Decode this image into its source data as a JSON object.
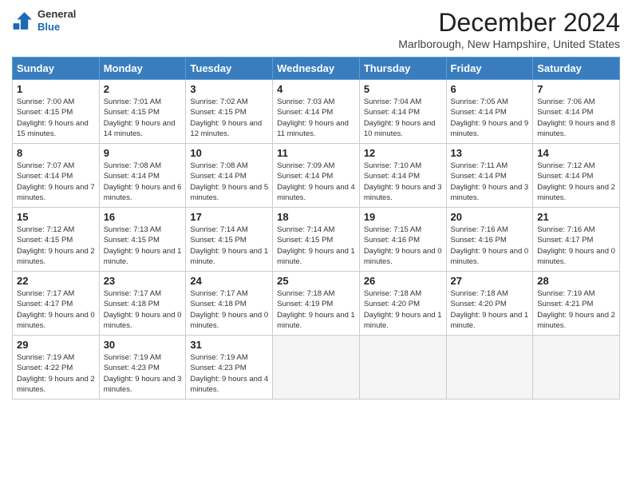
{
  "logo": {
    "line1": "General",
    "line2": "Blue"
  },
  "title": "December 2024",
  "subtitle": "Marlborough, New Hampshire, United States",
  "days_of_week": [
    "Sunday",
    "Monday",
    "Tuesday",
    "Wednesday",
    "Thursday",
    "Friday",
    "Saturday"
  ],
  "weeks": [
    [
      {
        "day": "1",
        "sunrise": "Sunrise: 7:00 AM",
        "sunset": "Sunset: 4:15 PM",
        "daylight": "Daylight: 9 hours and 15 minutes."
      },
      {
        "day": "2",
        "sunrise": "Sunrise: 7:01 AM",
        "sunset": "Sunset: 4:15 PM",
        "daylight": "Daylight: 9 hours and 14 minutes."
      },
      {
        "day": "3",
        "sunrise": "Sunrise: 7:02 AM",
        "sunset": "Sunset: 4:15 PM",
        "daylight": "Daylight: 9 hours and 12 minutes."
      },
      {
        "day": "4",
        "sunrise": "Sunrise: 7:03 AM",
        "sunset": "Sunset: 4:14 PM",
        "daylight": "Daylight: 9 hours and 11 minutes."
      },
      {
        "day": "5",
        "sunrise": "Sunrise: 7:04 AM",
        "sunset": "Sunset: 4:14 PM",
        "daylight": "Daylight: 9 hours and 10 minutes."
      },
      {
        "day": "6",
        "sunrise": "Sunrise: 7:05 AM",
        "sunset": "Sunset: 4:14 PM",
        "daylight": "Daylight: 9 hours and 9 minutes."
      },
      {
        "day": "7",
        "sunrise": "Sunrise: 7:06 AM",
        "sunset": "Sunset: 4:14 PM",
        "daylight": "Daylight: 9 hours and 8 minutes."
      }
    ],
    [
      {
        "day": "8",
        "sunrise": "Sunrise: 7:07 AM",
        "sunset": "Sunset: 4:14 PM",
        "daylight": "Daylight: 9 hours and 7 minutes."
      },
      {
        "day": "9",
        "sunrise": "Sunrise: 7:08 AM",
        "sunset": "Sunset: 4:14 PM",
        "daylight": "Daylight: 9 hours and 6 minutes."
      },
      {
        "day": "10",
        "sunrise": "Sunrise: 7:08 AM",
        "sunset": "Sunset: 4:14 PM",
        "daylight": "Daylight: 9 hours and 5 minutes."
      },
      {
        "day": "11",
        "sunrise": "Sunrise: 7:09 AM",
        "sunset": "Sunset: 4:14 PM",
        "daylight": "Daylight: 9 hours and 4 minutes."
      },
      {
        "day": "12",
        "sunrise": "Sunrise: 7:10 AM",
        "sunset": "Sunset: 4:14 PM",
        "daylight": "Daylight: 9 hours and 3 minutes."
      },
      {
        "day": "13",
        "sunrise": "Sunrise: 7:11 AM",
        "sunset": "Sunset: 4:14 PM",
        "daylight": "Daylight: 9 hours and 3 minutes."
      },
      {
        "day": "14",
        "sunrise": "Sunrise: 7:12 AM",
        "sunset": "Sunset: 4:14 PM",
        "daylight": "Daylight: 9 hours and 2 minutes."
      }
    ],
    [
      {
        "day": "15",
        "sunrise": "Sunrise: 7:12 AM",
        "sunset": "Sunset: 4:15 PM",
        "daylight": "Daylight: 9 hours and 2 minutes."
      },
      {
        "day": "16",
        "sunrise": "Sunrise: 7:13 AM",
        "sunset": "Sunset: 4:15 PM",
        "daylight": "Daylight: 9 hours and 1 minute."
      },
      {
        "day": "17",
        "sunrise": "Sunrise: 7:14 AM",
        "sunset": "Sunset: 4:15 PM",
        "daylight": "Daylight: 9 hours and 1 minute."
      },
      {
        "day": "18",
        "sunrise": "Sunrise: 7:14 AM",
        "sunset": "Sunset: 4:15 PM",
        "daylight": "Daylight: 9 hours and 1 minute."
      },
      {
        "day": "19",
        "sunrise": "Sunrise: 7:15 AM",
        "sunset": "Sunset: 4:16 PM",
        "daylight": "Daylight: 9 hours and 0 minutes."
      },
      {
        "day": "20",
        "sunrise": "Sunrise: 7:16 AM",
        "sunset": "Sunset: 4:16 PM",
        "daylight": "Daylight: 9 hours and 0 minutes."
      },
      {
        "day": "21",
        "sunrise": "Sunrise: 7:16 AM",
        "sunset": "Sunset: 4:17 PM",
        "daylight": "Daylight: 9 hours and 0 minutes."
      }
    ],
    [
      {
        "day": "22",
        "sunrise": "Sunrise: 7:17 AM",
        "sunset": "Sunset: 4:17 PM",
        "daylight": "Daylight: 9 hours and 0 minutes."
      },
      {
        "day": "23",
        "sunrise": "Sunrise: 7:17 AM",
        "sunset": "Sunset: 4:18 PM",
        "daylight": "Daylight: 9 hours and 0 minutes."
      },
      {
        "day": "24",
        "sunrise": "Sunrise: 7:17 AM",
        "sunset": "Sunset: 4:18 PM",
        "daylight": "Daylight: 9 hours and 0 minutes."
      },
      {
        "day": "25",
        "sunrise": "Sunrise: 7:18 AM",
        "sunset": "Sunset: 4:19 PM",
        "daylight": "Daylight: 9 hours and 1 minute."
      },
      {
        "day": "26",
        "sunrise": "Sunrise: 7:18 AM",
        "sunset": "Sunset: 4:20 PM",
        "daylight": "Daylight: 9 hours and 1 minute."
      },
      {
        "day": "27",
        "sunrise": "Sunrise: 7:18 AM",
        "sunset": "Sunset: 4:20 PM",
        "daylight": "Daylight: 9 hours and 1 minute."
      },
      {
        "day": "28",
        "sunrise": "Sunrise: 7:19 AM",
        "sunset": "Sunset: 4:21 PM",
        "daylight": "Daylight: 9 hours and 2 minutes."
      }
    ],
    [
      {
        "day": "29",
        "sunrise": "Sunrise: 7:19 AM",
        "sunset": "Sunset: 4:22 PM",
        "daylight": "Daylight: 9 hours and 2 minutes."
      },
      {
        "day": "30",
        "sunrise": "Sunrise: 7:19 AM",
        "sunset": "Sunset: 4:23 PM",
        "daylight": "Daylight: 9 hours and 3 minutes."
      },
      {
        "day": "31",
        "sunrise": "Sunrise: 7:19 AM",
        "sunset": "Sunset: 4:23 PM",
        "daylight": "Daylight: 9 hours and 4 minutes."
      },
      null,
      null,
      null,
      null
    ]
  ]
}
